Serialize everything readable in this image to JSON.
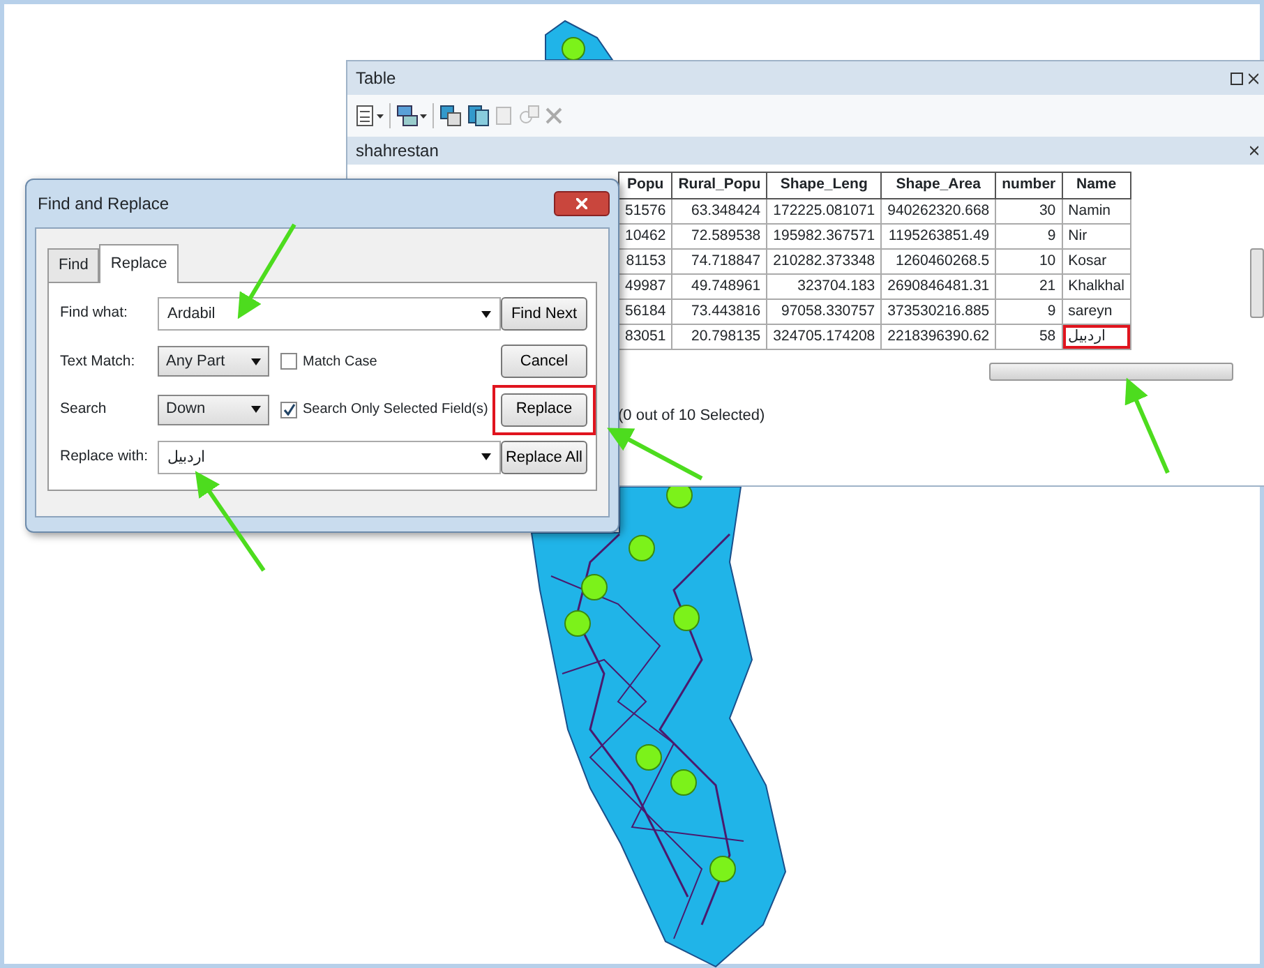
{
  "table_window": {
    "title": "Table",
    "layer_tab": "shahrestan",
    "columns": [
      "Popu",
      "Rural_Popu",
      "Shape_Leng",
      "Shape_Area",
      "number",
      "Name"
    ],
    "rows": [
      {
        "cells": [
          "51576",
          "63.348424",
          "172225.081071",
          "940262320.668",
          "30",
          "Namin"
        ],
        "highlighted": false
      },
      {
        "cells": [
          "10462",
          "72.589538",
          "195982.367571",
          "1195263851.49",
          "9",
          "Nir"
        ],
        "highlighted": false
      },
      {
        "cells": [
          "81153",
          "74.718847",
          "210282.373348",
          "1260460268.5",
          "10",
          "Kosar"
        ],
        "highlighted": false
      },
      {
        "cells": [
          "49987",
          "49.748961",
          "323704.183",
          "2690846481.31",
          "21",
          "Khalkhal"
        ],
        "highlighted": false
      },
      {
        "cells": [
          "56184",
          "73.443816",
          "97058.330757",
          "373530216.885",
          "9",
          "sareyn"
        ],
        "highlighted": false
      },
      {
        "cells": [
          "83051",
          "20.798135",
          "324705.174208",
          "2218396390.62",
          "58",
          "اردبیل"
        ],
        "highlighted": true
      }
    ],
    "status": "(0 out of 10 Selected)"
  },
  "dialog": {
    "title": "Find and Replace",
    "tabs": [
      {
        "label": "Find",
        "selected": false
      },
      {
        "label": "Replace",
        "selected": true
      }
    ],
    "find_what": {
      "label": "Find what:",
      "value": "Ardabil"
    },
    "text_match": {
      "label": "Text Match:",
      "value": "Any Part"
    },
    "match_case": {
      "label": "Match Case",
      "checked": false
    },
    "search": {
      "label": "Search",
      "value": "Down"
    },
    "selected_fields": {
      "label": "Search Only Selected Field(s)",
      "checked": true
    },
    "replace_with": {
      "label": "Replace with:",
      "value": "اردبیل"
    },
    "buttons": [
      {
        "label": "Find Next",
        "highlighted": false
      },
      {
        "label": "Cancel",
        "highlighted": false
      },
      {
        "label": "Replace",
        "highlighted": true
      },
      {
        "label": "Replace All",
        "highlighted": false
      }
    ]
  }
}
